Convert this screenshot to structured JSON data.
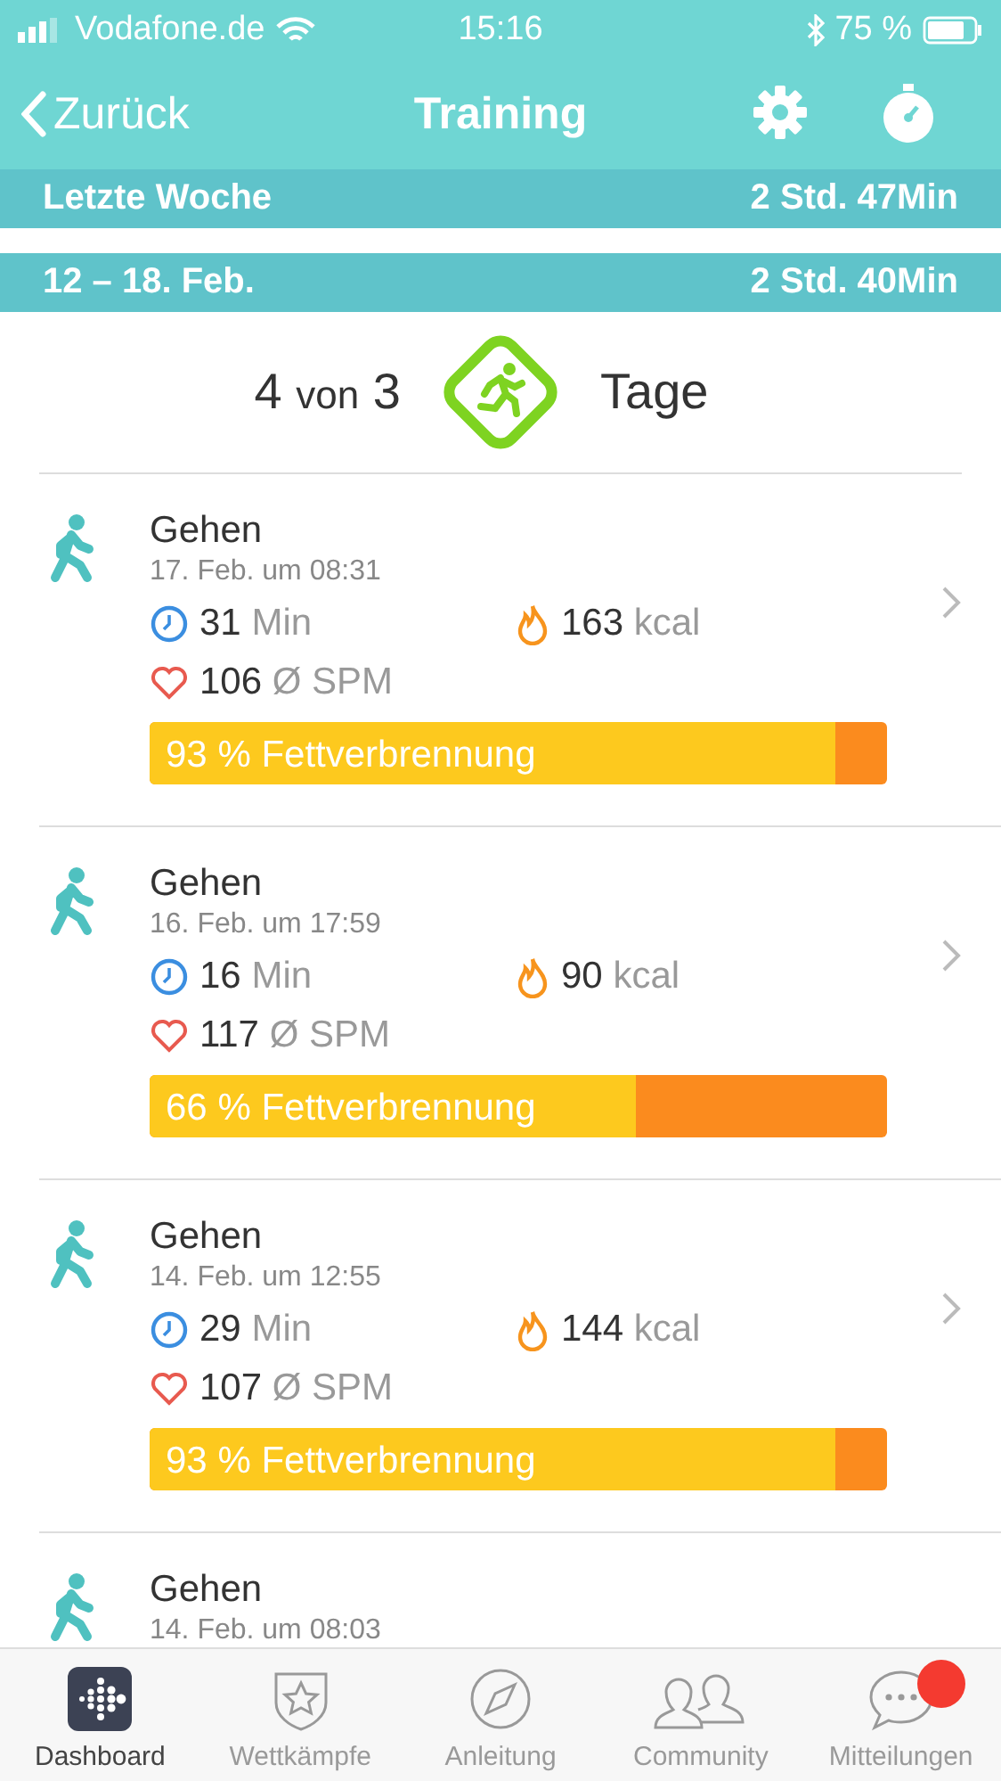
{
  "status_bar": {
    "carrier": "Vodafone.de",
    "time": "15:16",
    "battery": "75 %"
  },
  "nav": {
    "back": "Zurück",
    "title": "Training"
  },
  "periods": [
    {
      "label": "Letzte Woche",
      "total": "2 Std. 47Min"
    },
    {
      "label": "12 – 18. Feb.",
      "total": "2 Std. 40Min"
    }
  ],
  "summary": {
    "count": "4",
    "of": "von",
    "goal": "3",
    "unit": "Tage"
  },
  "activities": [
    {
      "name": "Gehen",
      "date": "17. Feb. um 08:31",
      "duration": "31",
      "duration_unit": "Min",
      "calories": "163",
      "calories_unit": "kcal",
      "heart_rate": "106",
      "heart_rate_unit": "Ø SPM",
      "fat_burn": "93 % Fettverbrennung",
      "level": 0.93
    },
    {
      "name": "Gehen",
      "date": "16. Feb. um 17:59",
      "duration": "16",
      "duration_unit": "Min",
      "calories": "90",
      "calories_unit": "kcal",
      "heart_rate": "117",
      "heart_rate_unit": "Ø SPM",
      "fat_burn": "66 % Fettverbrennung",
      "level": 0.66
    },
    {
      "name": "Gehen",
      "date": "14. Feb. um 12:55",
      "duration": "29",
      "duration_unit": "Min",
      "calories": "144",
      "calories_unit": "kcal",
      "heart_rate": "107",
      "heart_rate_unit": "Ø SPM",
      "fat_burn": "93 % Fettverbrennung",
      "level": 0.93
    },
    {
      "name": "Gehen",
      "date": "14. Feb. um 08:03"
    }
  ],
  "tabs": [
    {
      "label": "Dashboard",
      "selected": true,
      "badge": false
    },
    {
      "label": "Wettkämpfe",
      "selected": false,
      "badge": false
    },
    {
      "label": "Anleitung",
      "selected": false,
      "badge": false
    },
    {
      "label": "Community",
      "selected": false,
      "badge": false
    },
    {
      "label": "Mitteilungen",
      "selected": false,
      "badge": true
    }
  ]
}
